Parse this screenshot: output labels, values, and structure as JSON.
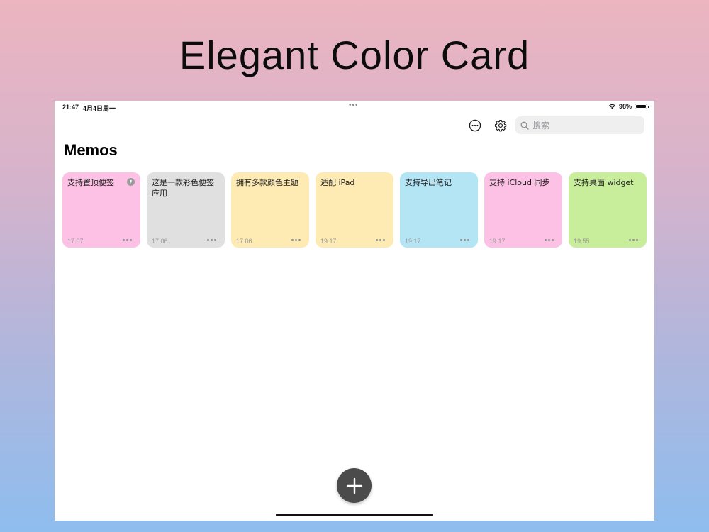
{
  "headline": "Elegant Color Card",
  "status_bar": {
    "time": "21:47",
    "date": "4月4日周一",
    "multitask": "•••",
    "battery": "98%",
    "battery_level": 0.98
  },
  "toolbar": {
    "more_icon": "ellipsis-circle-icon",
    "settings_icon": "gear-icon",
    "search_placeholder": "搜索"
  },
  "page_title": "Memos",
  "cards": [
    {
      "text": "支持置顶便签",
      "time": "17:07",
      "color": "#fcc1e4",
      "pinned": true
    },
    {
      "text": "这是一款彩色便签应用",
      "time": "17:06",
      "color": "#e0e0e0",
      "pinned": false
    },
    {
      "text": "拥有多款颜色主题",
      "time": "17:06",
      "color": "#fdebb3",
      "pinned": false
    },
    {
      "text": "适配 iPad",
      "time": "19:17",
      "color": "#fdebb3",
      "pinned": false
    },
    {
      "text": "支持导出笔记",
      "time": "19:17",
      "color": "#b3e5f5",
      "pinned": false
    },
    {
      "text": "支持 iCloud 同步",
      "time": "19:17",
      "color": "#fcc1e4",
      "pinned": false
    },
    {
      "text": "支持桌面 widget",
      "time": "19:55",
      "color": "#c8ee9b",
      "pinned": false
    }
  ],
  "fab_icon": "plus-icon"
}
